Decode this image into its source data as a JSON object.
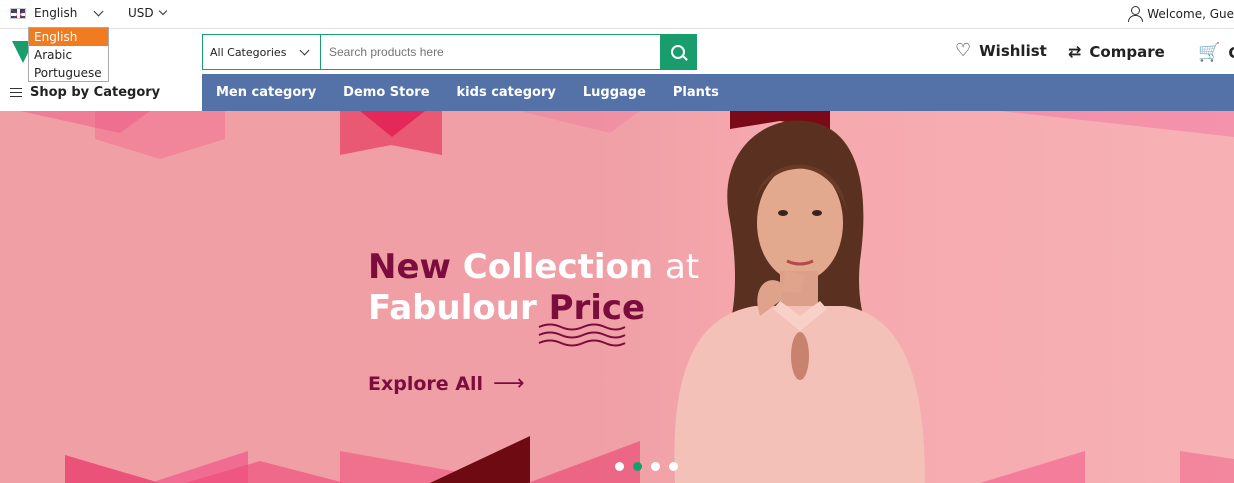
{
  "topbar": {
    "language": "English",
    "currency": "USD",
    "welcome": "Welcome, Gue"
  },
  "language_dropdown": {
    "options": [
      "English",
      "Arabic",
      "Portuguese"
    ],
    "selected": "English"
  },
  "header": {
    "logo_text": "y",
    "search_category": "All Categories",
    "search_placeholder": "Search products here",
    "wishlist": "Wishlist",
    "compare": "Compare",
    "cart": "Ca"
  },
  "nav": {
    "shop_by_category": "Shop by Category",
    "menu": [
      "Men category",
      "Demo Store",
      "kids category",
      "Luggage",
      "Plants"
    ]
  },
  "hero": {
    "line1_dark": "New",
    "line1_white": "Collection",
    "line1_light": "at",
    "line2_white": "Fabulour",
    "line2_dark": "Price",
    "cta": "Explore All",
    "slide_count": 4,
    "active_slide": 2
  },
  "colors": {
    "accent": "#1a9d6c",
    "nav_bg": "#5472a7",
    "dropdown_highlight": "#f07b20",
    "hero_dark_text": "#7b0d3d"
  }
}
